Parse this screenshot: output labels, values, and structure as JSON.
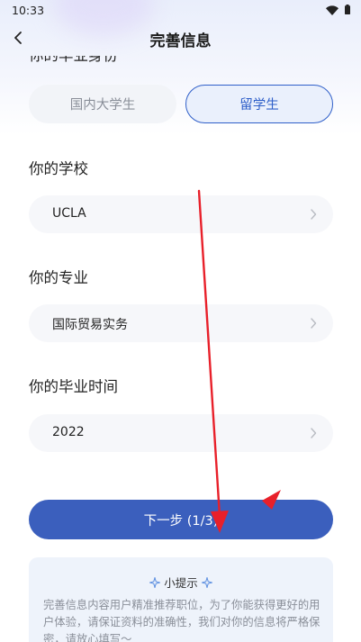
{
  "status_bar": {
    "time": "10:33"
  },
  "header": {
    "title": "完善信息"
  },
  "identity": {
    "label_partial": "你的毕业身份",
    "options": [
      "国内大学生",
      "留学生"
    ],
    "selected": "留学生"
  },
  "school": {
    "label": "你的学校",
    "value": "UCLA"
  },
  "major": {
    "label": "你的专业",
    "value": "国际贸易实务"
  },
  "graduation": {
    "label": "你的毕业时间",
    "value": "2022"
  },
  "next_button": {
    "label": "下一步 (1/3)"
  },
  "tips": {
    "title": "小提示",
    "body": "完善信息内容用户精准推荐职位，为了你能获得更好的用户体验，请保证资料的准确性，我们对你的信息将严格保密，请放心填写～"
  },
  "colors": {
    "accent": "#3b5fbd",
    "selected_border": "#2f5fc9",
    "annotation": "#e8202a"
  },
  "icons": [
    "back-arrow-icon",
    "wifi-icon",
    "battery-icon",
    "chevron-right-icon",
    "sparkle-icon"
  ]
}
